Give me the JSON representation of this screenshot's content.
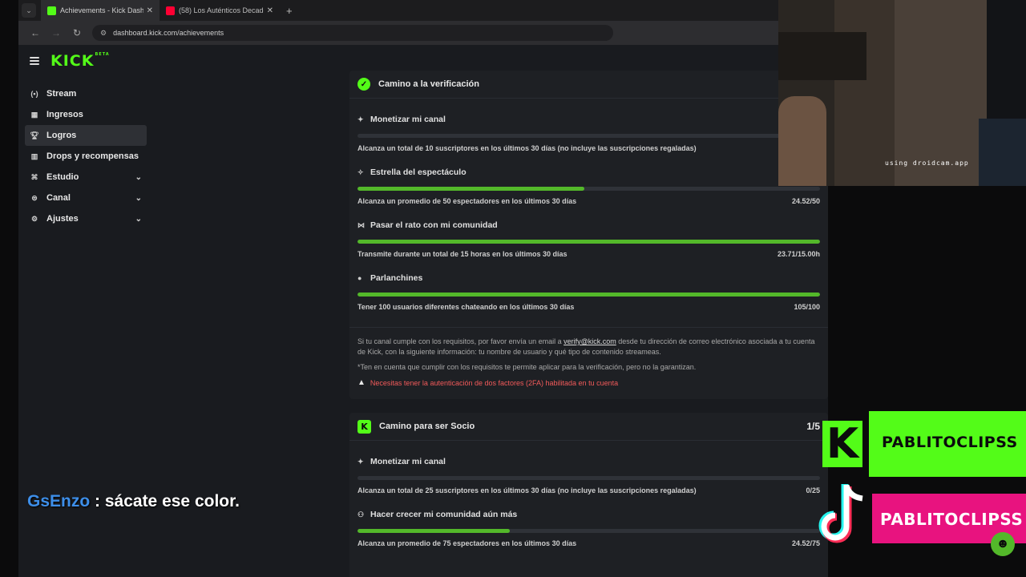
{
  "browser": {
    "tabs": [
      {
        "title": "Achievements - Kick Dashboard",
        "active": true,
        "favicon_color": "#53fc18"
      },
      {
        "title": "(58) Los Auténticos Decadentes",
        "active": false,
        "favicon_color": "#ff0033"
      }
    ],
    "url": "dashboard.kick.com/achievements"
  },
  "kick": {
    "logo": "KICK",
    "beta": "BETA",
    "sidebar": [
      {
        "label": "Stream",
        "icon": "broadcast-icon"
      },
      {
        "label": "Ingresos",
        "icon": "wallet-icon"
      },
      {
        "label": "Logros",
        "icon": "trophy-icon",
        "active": true
      },
      {
        "label": "Drops y recompensas",
        "icon": "gift-icon"
      },
      {
        "label": "Estudio",
        "icon": "studio-icon",
        "expandable": true
      },
      {
        "label": "Canal",
        "icon": "channel-icon",
        "expandable": true
      },
      {
        "label": "Ajustes",
        "icon": "gear-icon",
        "expandable": true
      }
    ]
  },
  "verification": {
    "title": "Camino a la verificación",
    "achievements": [
      {
        "title": "Monetizar mi canal",
        "description": "Alcanza un total de 10 suscriptores en los últimos 30 días (no incluye las suscripciones regaladas)",
        "progress_text": "",
        "progress": 0
      },
      {
        "title": "Estrella del espectáculo",
        "description": "Alcanza un promedio de 50 espectadores en los últimos 30 días",
        "progress_text": "24.52/50",
        "progress": 0.49
      },
      {
        "title": "Pasar el rato con mi comunidad",
        "description": "Transmite durante un total de 15 horas en los últimos 30 días",
        "progress_text": "23.71/15.00h",
        "progress": 1
      },
      {
        "title": "Parlanchines",
        "description": "Tener 100 usuarios diferentes chateando en los últimos 30 días",
        "progress_text": "105/100",
        "progress": 1
      }
    ],
    "info_before_link": "Si tu canal cumple con los requisitos, por favor envía un email a ",
    "info_link": "verify@kick.com",
    "info_after_link": " desde tu dirección de correo electrónico asociada a tu cuenta de Kick, con la siguiente información: tu nombre de usuario y qué tipo de contenido streameas.",
    "note": "*Ten en cuenta que cumplir con los requisitos te permite aplicar para la verificación, pero no la garantizan.",
    "warning": "Necesitas tener la autenticación de dos factores (2FA) habilitada en tu cuenta"
  },
  "partner": {
    "title": "Camino para ser Socio",
    "count": "1/5",
    "achievements": [
      {
        "title": "Monetizar mi canal",
        "description": "Alcanza un total de 25 suscriptores en los últimos 30 días (no incluye las suscripciones regaladas)",
        "progress_text": "0/25",
        "progress": 0
      },
      {
        "title": "Hacer crecer mi comunidad aún más",
        "description": "Alcanza un promedio de 75 espectadores en los últimos 30 días",
        "progress_text": "24.52/75",
        "progress": 0.33
      }
    ]
  },
  "chat": {
    "user": "GsEnzo",
    "message": " : sácate ese color."
  },
  "webcam": {
    "watermark": "using droidcam.app"
  },
  "overlay": {
    "kick_handle": "PABLITOCLIPSS",
    "tiktok_handle": "PABLITOCLIPSS"
  }
}
